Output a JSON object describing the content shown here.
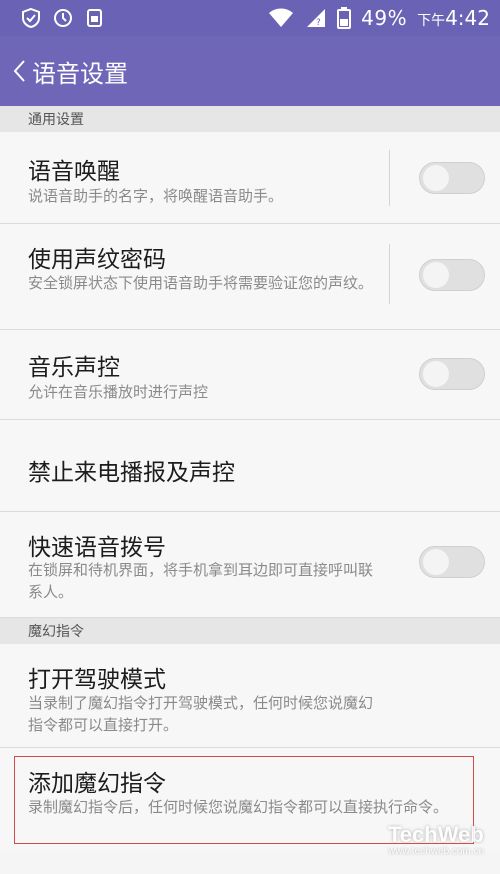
{
  "status_bar": {
    "battery_text": "49%",
    "time_prefix": "下午",
    "time": "4:42",
    "icons": [
      "shield-icon",
      "sync-icon",
      "sim-icon",
      "wifi-icon",
      "signal-icon",
      "battery-icon"
    ]
  },
  "app_bar": {
    "title": "语音设置",
    "back_icon": "chevron-left-icon"
  },
  "sections": {
    "general": "通用设置",
    "magic": "魔幻指令"
  },
  "rows": [
    {
      "title": "语音唤醒",
      "subtitle": "说语音助手的名字，将唤醒语音助手。",
      "toggle_on": false
    },
    {
      "title": "使用声纹密码",
      "subtitle": "安全锁屏状态下使用语音助手将需要验证您的声纹。",
      "toggle_on": false
    },
    {
      "title": "音乐声控",
      "subtitle": "允许在音乐播放时进行声控",
      "toggle_on": false
    },
    {
      "title": "禁止来电播报及声控"
    },
    {
      "title": "快速语音拨号",
      "subtitle": "在锁屏和待机界面，将手机拿到耳边即可直接呼叫联系人。",
      "toggle_on": false
    },
    {
      "title": "打开驾驶模式",
      "subtitle": "当录制了魔幻指令打开驾驶模式，任何时候您说魔幻指令都可以直接打开。"
    },
    {
      "title": "添加魔幻指令",
      "subtitle": "录制魔幻指令后，任何时候您说魔幻指令都可以直接执行命令。"
    }
  ],
  "watermark": {
    "brand": "TechWeb",
    "url": "www.techweb.com.cn"
  },
  "colors": {
    "status_bar": "#6a62b4",
    "app_bar": "#6f66b8",
    "highlight": "#d24a4a"
  }
}
